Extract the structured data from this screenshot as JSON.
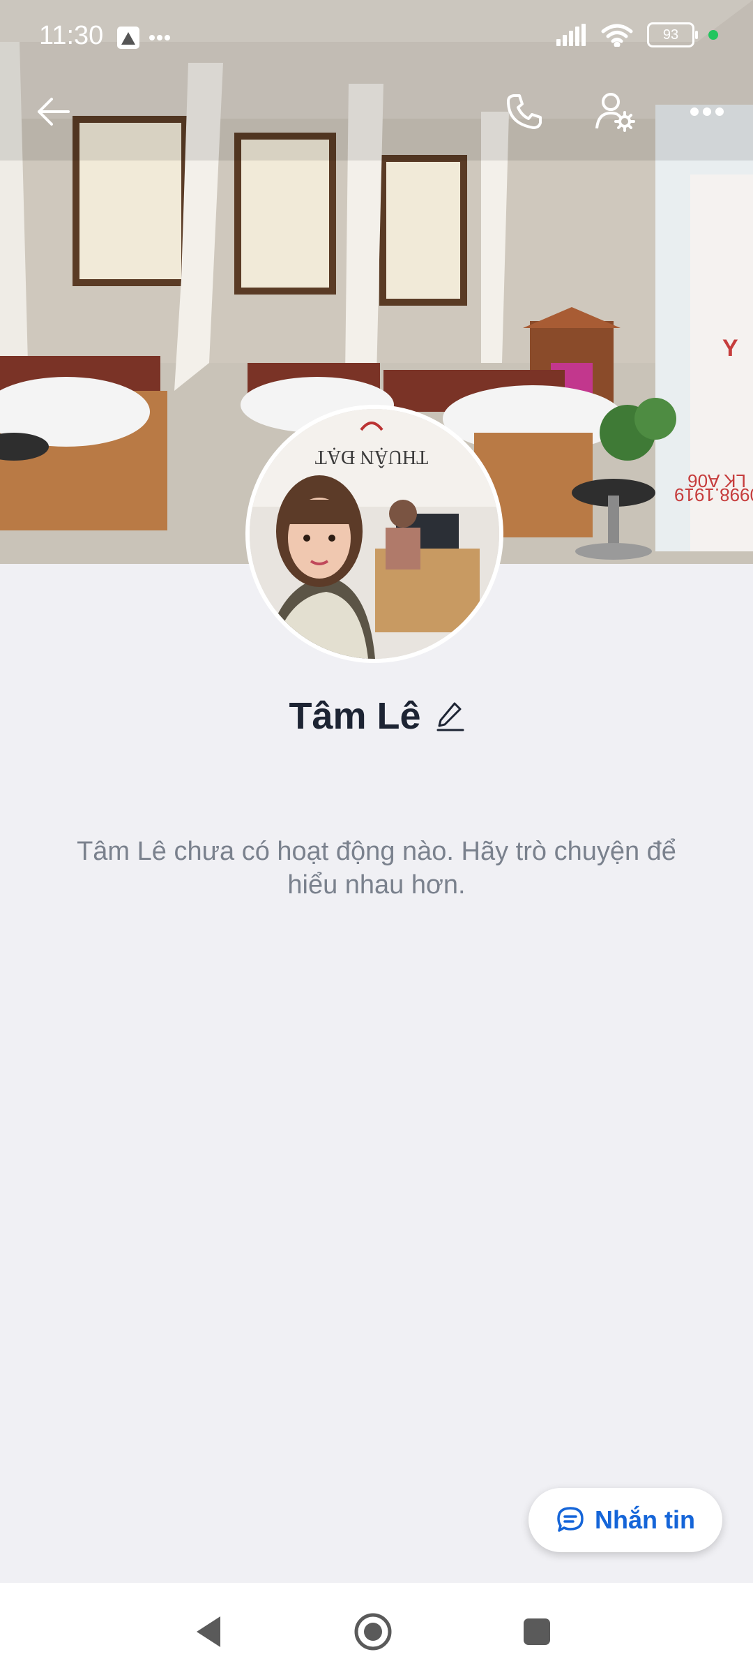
{
  "status_bar": {
    "time": "11:30",
    "battery": "93",
    "icons": [
      "photo-icon",
      "more-dots-icon",
      "signal-icon",
      "wifi-icon",
      "battery-icon",
      "green-dot-icon"
    ]
  },
  "top_actions": {
    "icons": [
      "back-arrow-icon",
      "phone-icon",
      "user-settings-icon",
      "more-icon"
    ]
  },
  "profile": {
    "name": "Tâm Lê",
    "empty_message": "Tâm Lê chưa có hoạt động nào. Hãy trò chuyện để hiểu nhau hơn."
  },
  "cover_photo": {
    "sign_letter": "Y",
    "sign_text": "LK A06",
    "sign_phone": "0998.1919"
  },
  "avatar_photo": {
    "logo_text": "THUẬN ĐẠT"
  },
  "actions": {
    "message_label": "Nhắn tin"
  },
  "colors": {
    "accent": "#1565d8",
    "background": "#f0f0f4",
    "status_green": "#22c55e"
  }
}
